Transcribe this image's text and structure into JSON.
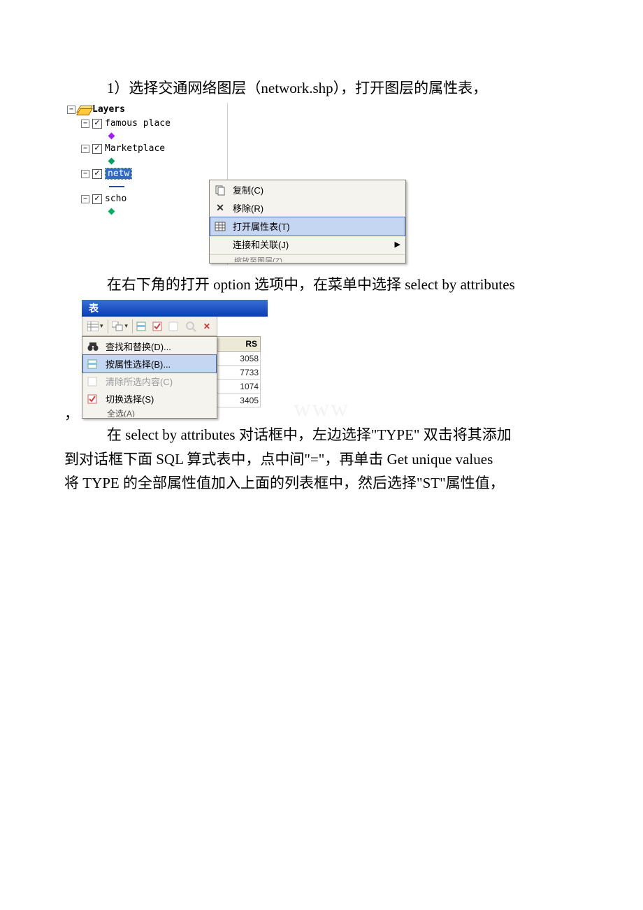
{
  "paragraphs": {
    "p1": "1）选择交通网络图层（network.shp），打开图层的属性表，",
    "p2": "在右下角的打开 option 选项中，在菜单中选择 select by attributes",
    "p3a": "在 select by attributes 对话框中，左边选择\"TYPE\" 双击将其添加",
    "p3b": "到对话框下面 SQL 算式表中，点中间\"=\"，再单击 Get unique values",
    "p3c": "将 TYPE 的全部属性值加入上面的列表框中，然后选择\"ST\"属性值，"
  },
  "shot1": {
    "root": "Layers",
    "layers": {
      "famous": "famous place",
      "market": "Marketplace",
      "network_sel": "netw",
      "school": "scho"
    },
    "context_menu": {
      "copy": "复制(C)",
      "remove": "移除(R)",
      "open_attr": "打开属性表(T)",
      "join_relate": "连接和关联(J)",
      "cut_row": "缩放至图层(Z)"
    }
  },
  "shot2": {
    "title": "表",
    "menu": {
      "find_replace": "查找和替换(D)...",
      "select_by_attr": "按属性选择(B)...",
      "clear_sel": "清除所选内容(C)",
      "switch_sel": "切换选择(S)",
      "cut_row": "全选(A)"
    },
    "grid_header": "RS",
    "grid_values": [
      "3058",
      "7733",
      "1074",
      "3405"
    ]
  },
  "watermark": "www"
}
